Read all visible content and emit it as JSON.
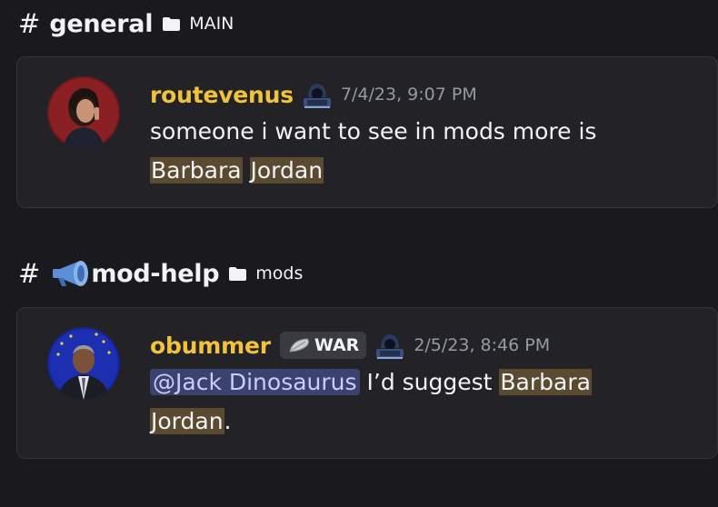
{
  "results": [
    {
      "channel": "general",
      "category": "MAIN",
      "hash": "#",
      "message": {
        "username": "routevenus",
        "timestamp": "7/4/23, 9:07 PM",
        "text_before": "someone i want to see in mods more is",
        "highlight_1": "Barbara",
        "highlight_2": "Jordan"
      }
    },
    {
      "channel": "mod-help",
      "category": "mods",
      "hash": "#",
      "message": {
        "username": "obummer",
        "tag": "WAR",
        "timestamp": "2/5/23, 8:46 PM",
        "mention": "@Jack Dinosaurus",
        "text_mid": "I’d suggest",
        "highlight_1": "Barbara",
        "highlight_2": "Jordan",
        "text_after": "."
      }
    }
  ],
  "colors": {
    "username": "#f0c33c",
    "highlight": "#5a4a30",
    "mention_bg": "#3c4270",
    "card_bg": "#222227"
  }
}
